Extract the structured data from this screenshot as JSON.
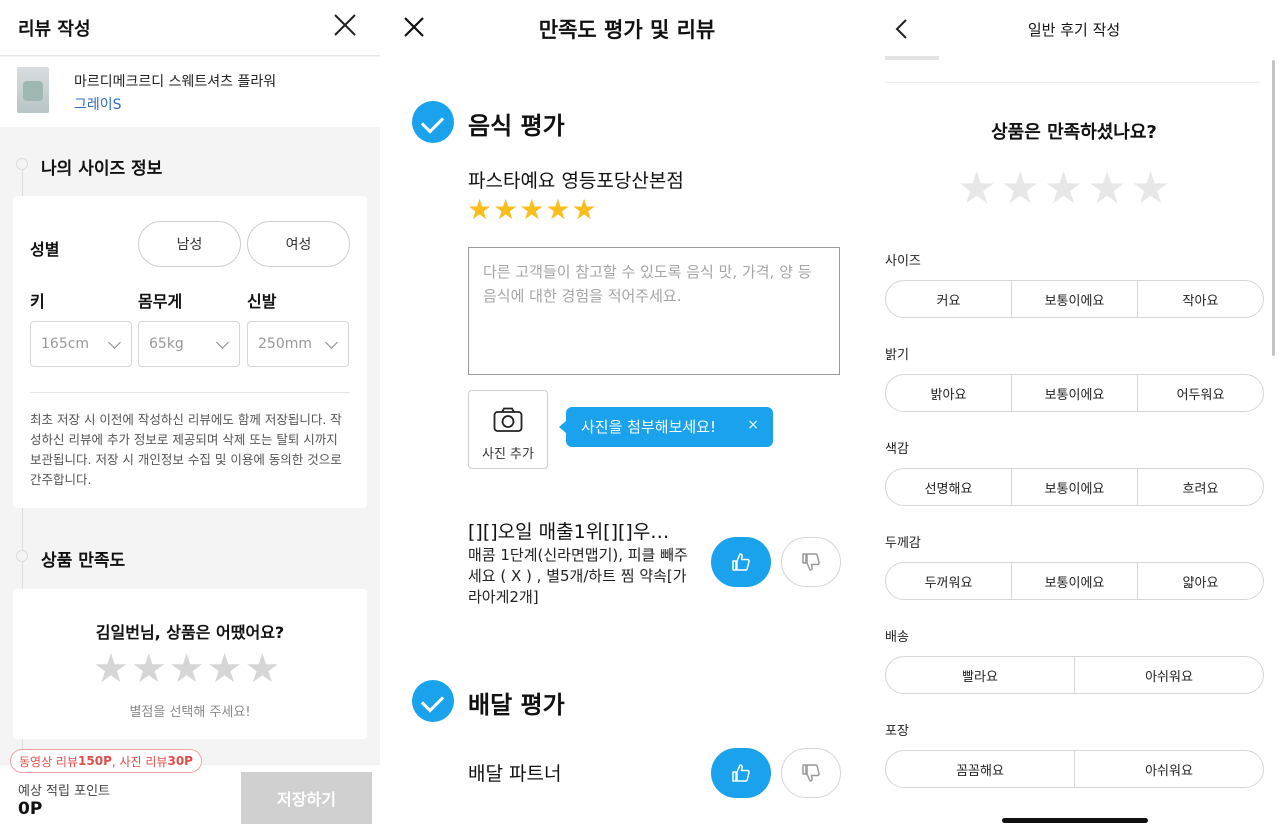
{
  "panel1": {
    "title": "리뷰 작성",
    "product_name": "마르디메크르디 스웨트셔츠 플라워",
    "product_option": "그레이S",
    "size_section": "나의 사이즈 정보",
    "gender_label": "성별",
    "gender_options": [
      "남성",
      "여성"
    ],
    "height_label": "키",
    "weight_label": "몸무게",
    "shoe_label": "신발",
    "height_value": "165cm",
    "weight_value": "65kg",
    "shoe_value": "250mm",
    "notice": "최초 저장 시 이전에 작성하신 리뷰에도 함께 저장됩니다. 작성하신 리뷰에 추가 정보로 제공되며 삭제 또는 탈퇴 시까지 보관됩니다. 저장 시 개인정보 수집 및 이용에 동의한 것으로 간주합니다.",
    "satisfaction_section": "상품 만족도",
    "satisfaction_question": "김일번님, 상품은 어땠어요?",
    "star_hint": "별점을 선택해 주세요!",
    "promo_prefix": "동영상 리뷰 ",
    "promo_video": "150P",
    "promo_middle": ", 사진 리뷰 ",
    "promo_photo": "30P",
    "points_label": "예상 적립 포인트",
    "points_value": "0P",
    "save_button": "저장하기",
    "rating": 0
  },
  "panel2": {
    "title": "만족도 평가 및 리뷰",
    "food_section": "음식 평가",
    "store_name": "파스타예요 영등포당산본점",
    "rating": 5,
    "review_placeholder": "다른 고객들이 참고할 수 있도록 음식 맛, 가격, 양 등 음식에 대한 경험을 적어주세요.",
    "photo_add": "사진 추가",
    "tooltip": "사진을 첨부해보세요!",
    "tooltip_close": "×",
    "menu_name": "[][]오일 매출1위[][]우…",
    "menu_options": "매콤 1단계(신라면맵기), 피클 빼주세요 ( X ) , 별5개/하트 찜 약속[가라아게2개]",
    "delivery_section": "배달 평가",
    "delivery_partner": "배달 파트너"
  },
  "panel3": {
    "title": "일반 후기 작성",
    "question": "상품은 만족하셨나요?",
    "rating": 0,
    "options": [
      {
        "label": "사이즈",
        "choices": [
          "커요",
          "보통이에요",
          "작아요"
        ]
      },
      {
        "label": "밝기",
        "choices": [
          "밝아요",
          "보통이에요",
          "어두워요"
        ]
      },
      {
        "label": "색감",
        "choices": [
          "선명해요",
          "보통이에요",
          "흐려요"
        ]
      },
      {
        "label": "두께감",
        "choices": [
          "두꺼워요",
          "보통이에요",
          "얇아요"
        ]
      },
      {
        "label": "배송",
        "choices": [
          "빨라요",
          "아쉬워요"
        ]
      },
      {
        "label": "포장",
        "choices": [
          "꼼꼼해요",
          "아쉬워요"
        ]
      }
    ]
  },
  "colors": {
    "accent_blue": "#1aa3ec",
    "star_yellow": "#f9bd1c",
    "star_gray": "#d6d6d6",
    "promo_red": "#e14d4d",
    "disabled_button": "#d0d0d0"
  }
}
